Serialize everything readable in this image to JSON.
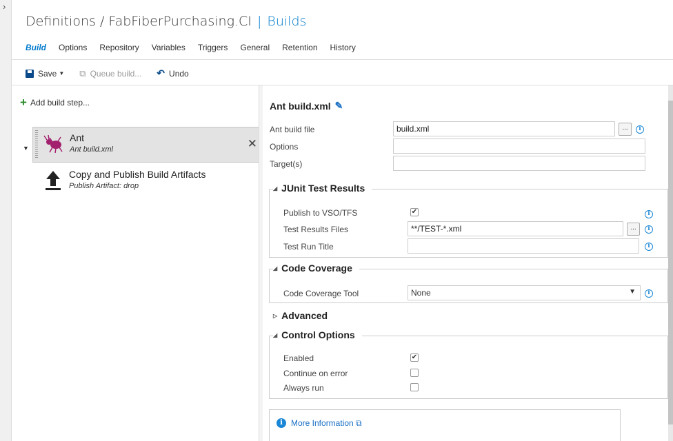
{
  "header": {
    "breadcrumb_root": "Definitions",
    "breadcrumb_sep": "/",
    "definition_name": "FabFiberPurchasing.CI",
    "pipe": "|",
    "section": "Builds"
  },
  "tabs": [
    "Build",
    "Options",
    "Repository",
    "Variables",
    "Triggers",
    "General",
    "Retention",
    "History"
  ],
  "toolbar": {
    "save_label": "Save",
    "queue_label": "Queue build...",
    "undo_label": "Undo"
  },
  "left": {
    "add_step_label": "Add build step...",
    "steps": [
      {
        "name": "Ant",
        "sub": "Ant build.xml",
        "icon": "ant-icon"
      },
      {
        "name": "Copy and Publish Build Artifacts",
        "sub": "Publish Artifact: drop",
        "icon": "upload-icon"
      }
    ]
  },
  "task": {
    "title": "Ant build.xml",
    "ant_build_file_label": "Ant build file",
    "ant_build_file_value": "build.xml",
    "options_label": "Options",
    "options_value": "",
    "targets_label": "Target(s)",
    "targets_value": ""
  },
  "junit": {
    "heading": "JUnit Test Results",
    "publish_label": "Publish to VSO/TFS",
    "publish_checked": true,
    "files_label": "Test Results Files",
    "files_value": "**/TEST-*.xml",
    "run_title_label": "Test Run Title",
    "run_title_value": ""
  },
  "coverage": {
    "heading": "Code Coverage",
    "tool_label": "Code Coverage Tool",
    "tool_value": "None"
  },
  "advanced": {
    "heading": "Advanced"
  },
  "control": {
    "heading": "Control Options",
    "enabled_label": "Enabled",
    "enabled_checked": true,
    "continue_label": "Continue on error",
    "continue_checked": false,
    "always_label": "Always run",
    "always_checked": false
  },
  "more_info": {
    "label": "More Information"
  },
  "colors": {
    "accent": "#007acc",
    "add_green": "#2b8a2b",
    "info_blue": "#1a86d6",
    "ant_purple": "#a3206f"
  }
}
